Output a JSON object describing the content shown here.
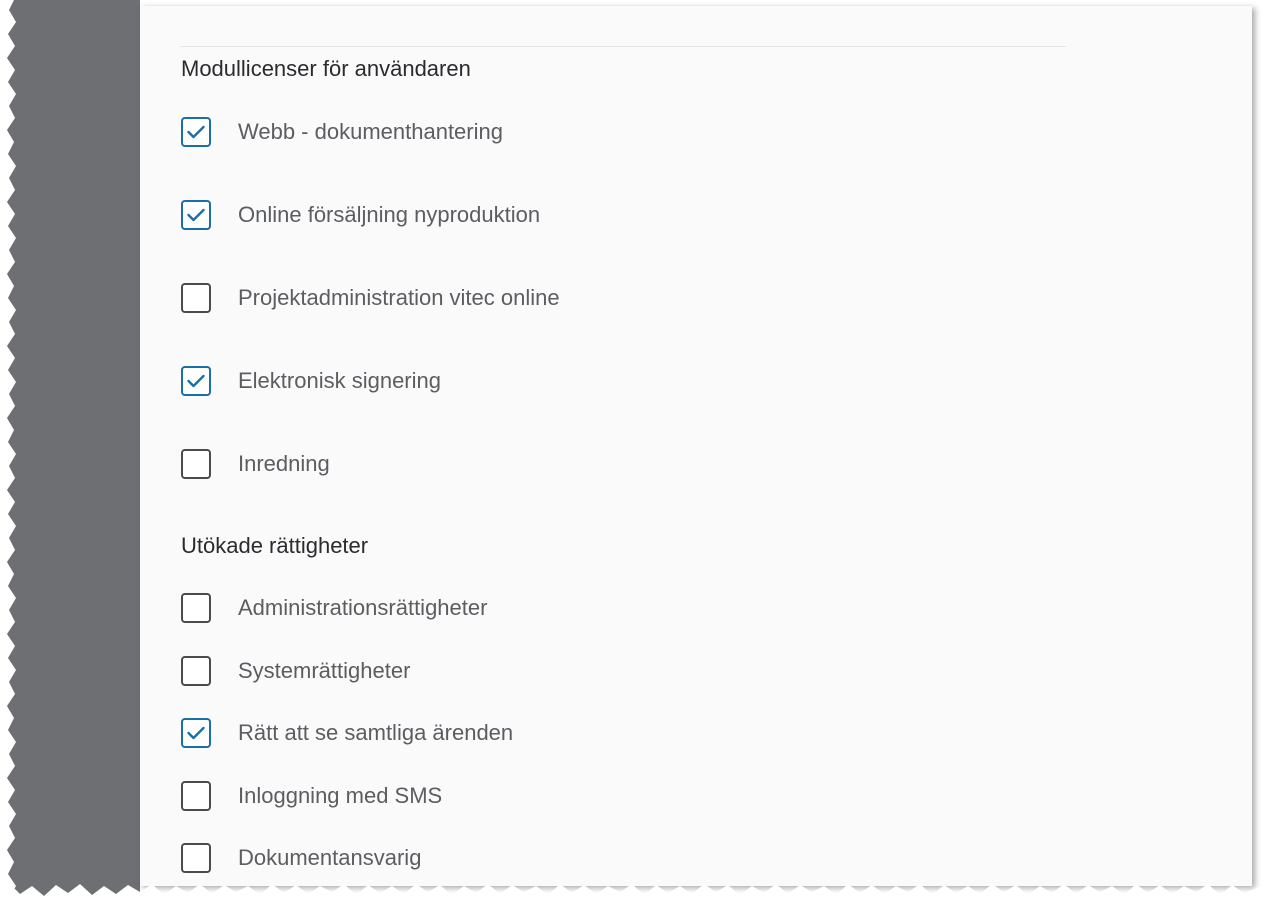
{
  "sections": {
    "modules": {
      "title": "Modullicenser för användaren",
      "items": [
        {
          "label": "Webb - dokumenthantering",
          "checked": true
        },
        {
          "label": "Online försäljning nyproduktion",
          "checked": true
        },
        {
          "label": "Projektadministration vitec online",
          "checked": false
        },
        {
          "label": "Elektronisk signering",
          "checked": true
        },
        {
          "label": "Inredning",
          "checked": false
        }
      ]
    },
    "rights": {
      "title": "Utökade rättigheter",
      "items": [
        {
          "label": "Administrationsrättigheter",
          "checked": false
        },
        {
          "label": "Systemrättigheter",
          "checked": false
        },
        {
          "label": "Rätt att se samtliga ärenden",
          "checked": true
        },
        {
          "label": "Inloggning med SMS",
          "checked": false
        },
        {
          "label": "Dokumentansvarig",
          "checked": false
        }
      ]
    }
  },
  "colors": {
    "checkbox_checked": "#1a6fa8",
    "checkbox_unchecked": "#4a4b4f",
    "sidebar": "#6d6f73"
  },
  "icons": {
    "checked": "checkmark-icon"
  }
}
